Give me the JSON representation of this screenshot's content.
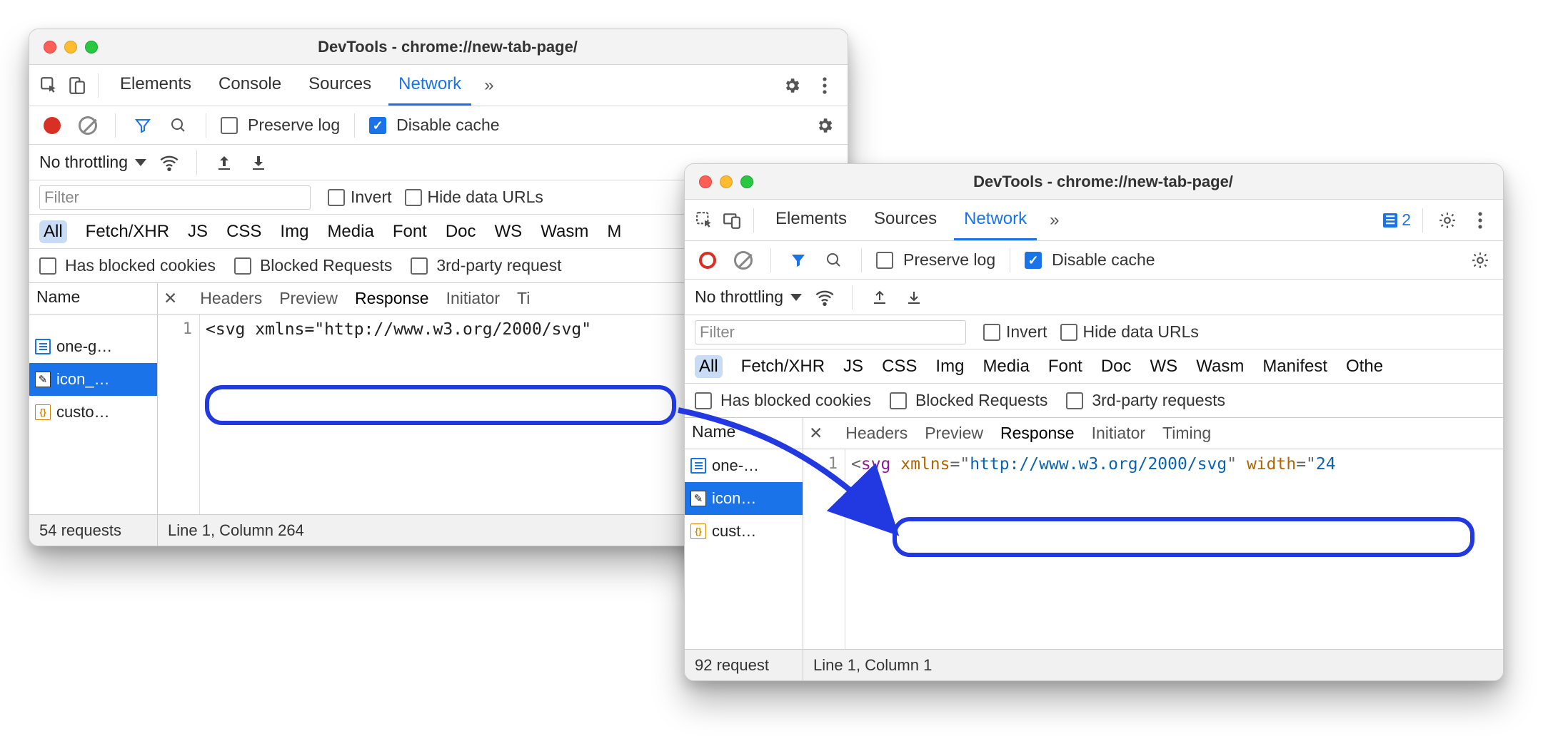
{
  "w1": {
    "title": "DevTools - chrome://new-tab-page/",
    "tabs": [
      "Elements",
      "Console",
      "Sources",
      "Network"
    ],
    "active_tab": "Network",
    "preserve_log": "Preserve log",
    "disable_cache": "Disable cache",
    "throttling": "No throttling",
    "filter_placeholder": "Filter",
    "invert": "Invert",
    "hide_data_urls": "Hide data URLs",
    "pills": [
      "All",
      "Fetch/XHR",
      "JS",
      "CSS",
      "Img",
      "Media",
      "Font",
      "Doc",
      "WS",
      "Wasm",
      "M"
    ],
    "opt_blocked_cookies": "Has blocked cookies",
    "opt_blocked_requests": "Blocked Requests",
    "opt_third_party": "3rd-party request",
    "col_header": "Name",
    "req_tabs": [
      "Headers",
      "Preview",
      "Response",
      "Initiator",
      "Ti"
    ],
    "req_active": "Response",
    "requests": [
      {
        "name": "one-g…",
        "icon": "doc"
      },
      {
        "name": "icon_…",
        "icon": "pen",
        "sel": true
      },
      {
        "name": "custo…",
        "icon": "js"
      }
    ],
    "line_number": "1",
    "code_plain": "<svg xmlns=\"http://www.w3.org/2000/svg\"",
    "status_left": "54 requests",
    "status_right": "Line 1, Column 264"
  },
  "w2": {
    "title": "DevTools - chrome://new-tab-page/",
    "tabs": [
      "Elements",
      "Sources",
      "Network"
    ],
    "active_tab": "Network",
    "issues_count": "2",
    "preserve_log": "Preserve log",
    "disable_cache": "Disable cache",
    "throttling": "No throttling",
    "filter_placeholder": "Filter",
    "invert": "Invert",
    "hide_data_urls": "Hide data URLs",
    "pills": [
      "All",
      "Fetch/XHR",
      "JS",
      "CSS",
      "Img",
      "Media",
      "Font",
      "Doc",
      "WS",
      "Wasm",
      "Manifest",
      "Othe"
    ],
    "opt_blocked_cookies": "Has blocked cookies",
    "opt_blocked_requests": "Blocked Requests",
    "opt_third_party": "3rd-party requests",
    "col_header": "Name",
    "req_tabs": [
      "Headers",
      "Preview",
      "Response",
      "Initiator",
      "Timing"
    ],
    "req_active": "Response",
    "requests": [
      {
        "name": "one-…",
        "icon": "doc"
      },
      {
        "name": "icon…",
        "icon": "pen",
        "sel": true
      },
      {
        "name": "cust…",
        "icon": "js"
      }
    ],
    "line_number": "1",
    "code_tokens": [
      {
        "c": "punc",
        "v": "<"
      },
      {
        "c": "tag",
        "v": "svg "
      },
      {
        "c": "attr",
        "v": "xmlns"
      },
      {
        "c": "punc",
        "v": "=\""
      },
      {
        "c": "str",
        "v": "http://www.w3.org/2000/svg"
      },
      {
        "c": "punc",
        "v": "\" "
      },
      {
        "c": "attr",
        "v": "width"
      },
      {
        "c": "punc",
        "v": "=\""
      },
      {
        "c": "str",
        "v": "24"
      }
    ],
    "status_left": "92 request",
    "status_right": "Line 1, Column 1"
  }
}
